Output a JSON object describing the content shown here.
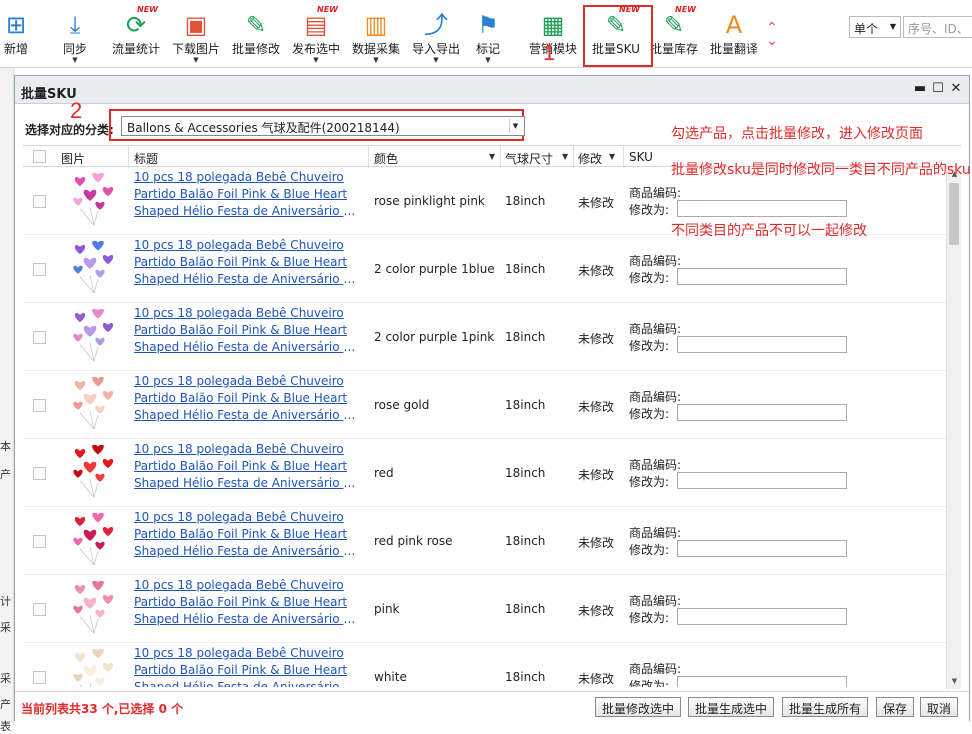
{
  "toolbar": {
    "items": [
      {
        "label": "新增",
        "icon": "add-grid-icon",
        "new": false
      },
      {
        "label": "同步",
        "icon": "download-sync-icon",
        "new": false
      },
      {
        "label": "流量统计",
        "icon": "refresh-stats-icon",
        "new": true
      },
      {
        "label": "下载图片",
        "icon": "image-download-icon",
        "new": false
      },
      {
        "label": "批量修改",
        "icon": "batch-edit-icon",
        "new": false
      },
      {
        "label": "发布选中",
        "icon": "publish-icon",
        "new": true
      },
      {
        "label": "数据采集",
        "icon": "data-collect-icon",
        "new": false
      },
      {
        "label": "导入导出",
        "icon": "import-export-icon",
        "new": false
      },
      {
        "label": "标记",
        "icon": "flag-icon",
        "new": false
      },
      {
        "label": "营销模块",
        "icon": "modules-icon",
        "new": false
      },
      {
        "label": "批量SKU",
        "icon": "batch-sku-icon",
        "new": true
      },
      {
        "label": "批量库存",
        "icon": "batch-stock-icon",
        "new": true
      },
      {
        "label": "批量翻译",
        "icon": "translate-icon",
        "new": false
      }
    ],
    "new_badge": "NEW",
    "mode_select": "单个",
    "search_placeholder": "序号、ID、"
  },
  "annotations": {
    "num1": "1",
    "num2": "2",
    "hint1": "勾选产品，点击批量修改，进入修改页面",
    "hint2": "批量修改sku是同时修改同一类目不同产品的sku",
    "hint3": "不同类目的产品不可以一起修改"
  },
  "left_strip": [
    "本",
    "产",
    "计",
    "采",
    "采",
    "产",
    "表"
  ],
  "dialog": {
    "title": "批量SKU",
    "category_label": "选择对应的分类:",
    "category_value": "Ballons & Accessories 气球及配件(200218144)",
    "columns": [
      "图片",
      "标题",
      "颜色",
      "气球尺寸",
      "修改",
      "SKU"
    ],
    "sku_code_label": "商品编码:",
    "modify_to_label": "修改为:",
    "rows": [
      {
        "title": [
          "10 pcs 18 polegada Bebê Chuveiro",
          "Partido Balão Foil Pink & Blue Heart",
          "Shaped Hélio Festa de Aniversário d..."
        ],
        "color": "rose pinklight pink",
        "size": "18inch",
        "status": "未修改",
        "palette": [
          "#e04fb0",
          "#f4a3d8",
          "#c53b9a"
        ]
      },
      {
        "title": [
          "10 pcs 18 polegada Bebê Chuveiro",
          "Partido Balão Foil Pink & Blue Heart",
          "Shaped Hélio Festa de Aniversário d..."
        ],
        "color": "2 color purple 1blue",
        "size": "18inch",
        "status": "未修改",
        "palette": [
          "#8a5bd6",
          "#4f7fe0",
          "#b59be8"
        ]
      },
      {
        "title": [
          "10 pcs 18 polegada Bebê Chuveiro",
          "Partido Balão Foil Pink & Blue Heart",
          "Shaped Hélio Festa de Aniversário d..."
        ],
        "color": "2 color purple 1pink",
        "size": "18inch",
        "status": "未修改",
        "palette": [
          "#8e5ed0",
          "#e38cc8",
          "#b79ae6"
        ]
      },
      {
        "title": [
          "10 pcs 18 polegada Bebê Chuveiro",
          "Partido Balão Foil Pink & Blue Heart",
          "Shaped Hélio Festa de Aniversário d..."
        ],
        "color": "rose gold",
        "size": "18inch",
        "status": "未修改",
        "palette": [
          "#f0b3a8",
          "#e89c8f",
          "#f6cfc6"
        ]
      },
      {
        "title": [
          "10 pcs 18 polegada Bebê Chuveiro",
          "Partido Balão Foil Pink & Blue Heart",
          "Shaped Hélio Festa de Aniversário d..."
        ],
        "color": "red",
        "size": "18inch",
        "status": "未修改",
        "palette": [
          "#e01818",
          "#c00f0f",
          "#f03a3a"
        ]
      },
      {
        "title": [
          "10 pcs 18 polegada Bebê Chuveiro",
          "Partido Balão Foil Pink & Blue Heart",
          "Shaped Hélio Festa de Aniversário d..."
        ],
        "color": "red pink rose",
        "size": "18inch",
        "status": "未修改",
        "palette": [
          "#e0203a",
          "#f06aa8",
          "#c81b57"
        ]
      },
      {
        "title": [
          "10 pcs 18 polegada Bebê Chuveiro",
          "Partido Balão Foil Pink & Blue Heart",
          "Shaped Hélio Festa de Aniversário d..."
        ],
        "color": "pink",
        "size": "18inch",
        "status": "未修改",
        "palette": [
          "#f08ea6",
          "#e67590",
          "#f7b3c3"
        ]
      },
      {
        "title": [
          "10 pcs 18 polegada Bebê Chuveiro",
          "Partido Balão Foil Pink & Blue Heart",
          "Shaped Hélio Festa de Aniversário d..."
        ],
        "color": "white",
        "size": "18inch",
        "status": "未修改",
        "palette": [
          "#f0e2cf",
          "#e8d4bb",
          "#f7eee2"
        ]
      }
    ],
    "footer": {
      "status": "当前列表共33 个,已选择 0 个",
      "btn_modify_selected": "批量修改选中",
      "btn_gen_selected": "批量生成选中",
      "btn_gen_all": "批量生成所有",
      "btn_save": "保存",
      "btn_cancel": "取消"
    }
  }
}
